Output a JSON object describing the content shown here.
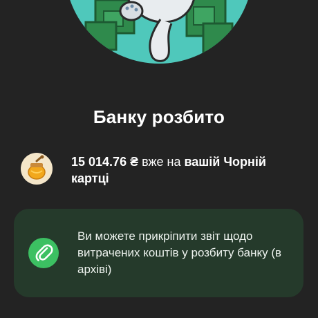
{
  "screen": {
    "title": "Банку розбито",
    "balance": {
      "amount": "15 014.76 ₴",
      "middle": " вже на ",
      "card_name": "вашій Чорній",
      "card_suffix": "картці"
    },
    "attach_card": {
      "text": "Ви можете прикріпити звіт щодо витрачених коштів у розбиту банку (в архіві)"
    }
  },
  "colors": {
    "background": "#232323",
    "hero_circle": "#4fc8bb",
    "card_background": "#253a2b",
    "clip_icon_background": "#3cc062",
    "honey_icon_background": "#f4e6c9"
  }
}
